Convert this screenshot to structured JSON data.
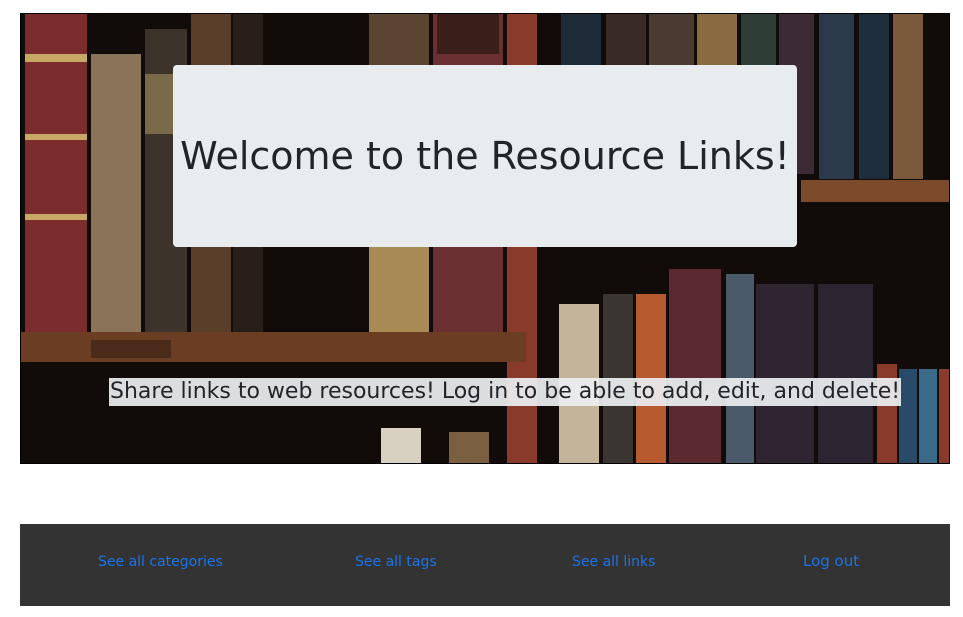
{
  "hero": {
    "welcome_title": "Welcome to the Resource Links!",
    "tagline": "Share links to web resources! Log in to be able to add, edit, and delete!",
    "background": "bookshelf-image"
  },
  "nav": {
    "categories": "See all categories",
    "tags": "See all tags",
    "links": "See all links",
    "logout": "Log out"
  },
  "colors": {
    "welcome_bg": "#e9ecef",
    "footer_bg": "#333333",
    "link": "#1a73e8"
  }
}
